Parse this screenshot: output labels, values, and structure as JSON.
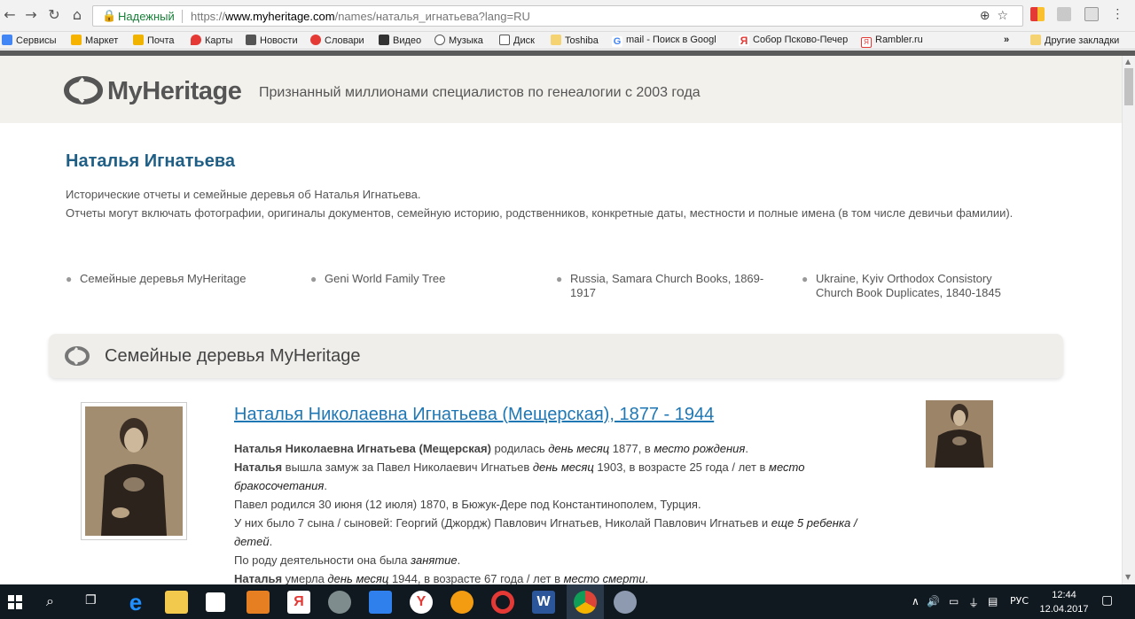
{
  "browser": {
    "secure_label": "Надежный",
    "url_scheme": "https://",
    "url_host": "www.myheritage.com",
    "url_path": "/names/наталья_игнатьева?lang=RU"
  },
  "bookmarks": [
    {
      "label": "Сервисы",
      "color": "#4285f4"
    },
    {
      "label": "Маркет",
      "color": "#f6b400"
    },
    {
      "label": "Почта",
      "color": "#f0b400"
    },
    {
      "label": "Карты",
      "color": "#e53935"
    },
    {
      "label": "Новости",
      "color": "#555555"
    },
    {
      "label": "Словари",
      "color": "#e53935"
    },
    {
      "label": "Видео",
      "color": "#333333"
    },
    {
      "label": "Музыка",
      "color": "#555555"
    },
    {
      "label": "Диск",
      "color": "#555555"
    },
    {
      "label": "Toshiba",
      "color": "#f5d372"
    },
    {
      "label": "mail - Поиск в Googl",
      "color": "#4285f4"
    },
    {
      "label": "Собор Псково-Печер",
      "color": "#e53935"
    },
    {
      "label": "Rambler.ru",
      "color": "#e53935"
    }
  ],
  "bookmarks_more": "»",
  "bookmarks_other": "Другие закладки",
  "site": {
    "logo_text": "MyHeritage",
    "tagline": "Признанный миллионами специалистов по генеалогии с 2003 года"
  },
  "person": {
    "name": "Наталья Игнатьева",
    "intro_line1": "Исторические отчеты и семейные деревья об Наталья Игнатьева.",
    "intro_line2": "Отчеты могут включать фотографии, оригиналы документов, семейную историю, родственников, конкретные даты, местности и полные имена (в том числе девичьи фамилии)."
  },
  "sources": [
    "Семейные деревья MyHeritage",
    "Geni World Family Tree",
    "Russia, Samara Church Books, 1869-1917",
    "Ukraine, Kyiv Orthodox Consistory Church Book Duplicates, 1840-1845"
  ],
  "section": {
    "title": "Семейные деревья MyHeritage"
  },
  "record": {
    "title": "Наталья Николаевна Игнатьева (Мещерская), 1877 - 1944",
    "l1_name": "Наталья Николаевна Игнатьева (Мещерская)",
    "l1_a": " родилась ",
    "l1_date": "день месяц",
    "l1_b": " 1877, в ",
    "l1_place": "место рождения",
    "l1_end": ".",
    "l2_name": "Наталья",
    "l2_a": " вышла замуж за Павел Николаевич Игнатьев ",
    "l2_date": "день месяц",
    "l2_b": " 1903, в возрасте 25 года / лет в ",
    "l2_place": "место бракосочетания",
    "l2_end": ".",
    "l3": "Павел родился 30 июня (12 июля) 1870, в Бюжук-Дере под Константинополем, Турция.",
    "l4_a": "У них было 7 сына / сыновей: Георгий (Джордж) Павлович Игнатьев, Николай Павлович Игнатьев и ",
    "l4_more": "еще 5 ребенка / детей",
    "l4_end": ".",
    "l5_a": "По роду деятельности она была ",
    "l5_job": "занятие",
    "l5_end": ".",
    "l6_name": "Наталья",
    "l6_a": " умерла ",
    "l6_date": "день месяц",
    "l6_b": " 1944, в возрасте 67 года / лет в ",
    "l6_place": "место смерти",
    "l6_end": "."
  },
  "taskbar": {
    "lang": "РУС",
    "time": "12:44",
    "date": "12.04.2017"
  }
}
